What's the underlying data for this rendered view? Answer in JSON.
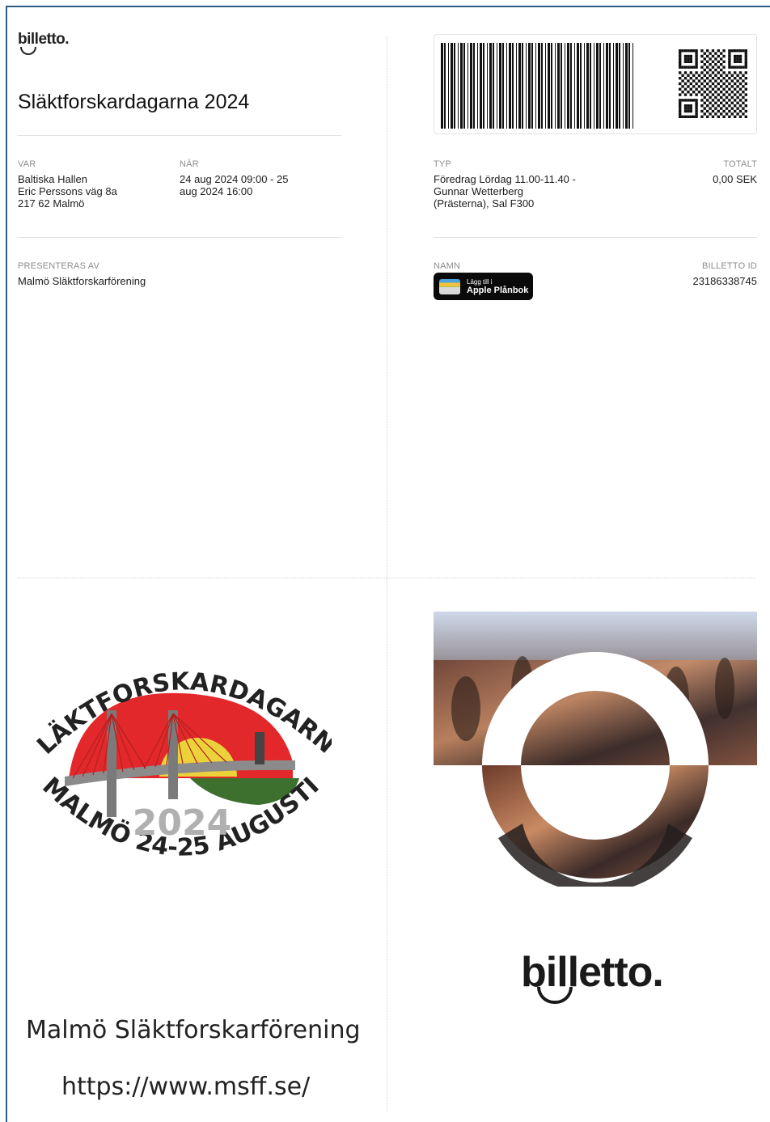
{
  "brand": {
    "logo_small": "billetto.",
    "logo_large": "billetto."
  },
  "event": {
    "title": "Släktforskardagarna 2024"
  },
  "where": {
    "label": "VAR",
    "line1": "Baltiska Hallen",
    "line2": "Eric Perssons väg 8a",
    "line3": "217 62 Malmö"
  },
  "when": {
    "label": "NÄR",
    "line1": "24 aug 2024 09:00 - 25",
    "line2": "aug 2024 16:00"
  },
  "presenter": {
    "label": "PRESENTERAS AV",
    "value": "Malmö Släktforskarförening"
  },
  "type": {
    "label": "TYP",
    "line1": "Föredrag Lördag 11.00-11.40 -",
    "line2": "Gunnar Wetterberg",
    "line3": "(Prästerna), Sal F300"
  },
  "total": {
    "label": "TOTALT",
    "value": "0,00 SEK"
  },
  "name": {
    "label": "NAMN"
  },
  "wallet_button": {
    "small": "Lägg till i",
    "big": "Apple Plånbok"
  },
  "ticket_id": {
    "label": "BILLETTO ID",
    "value": "23186338745"
  },
  "emblem": {
    "top_text": "SLÄKTFORSKARDAGARNA",
    "bottom_text": "MALMÖ 24-25 AUGUSTI",
    "year": "2024"
  },
  "footer": {
    "org": "Malmö Släktforskarförening",
    "url": "https://www.msff.se/"
  },
  "colors": {
    "emblem_red": "#e3282b",
    "emblem_sun": "#ecd23a",
    "emblem_green": "#3d6f2e",
    "frame_blue": "#2f5b80"
  }
}
